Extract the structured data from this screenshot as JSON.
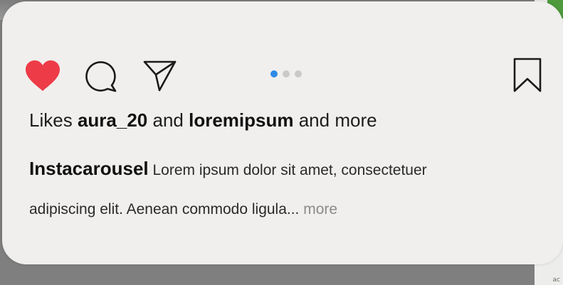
{
  "post": {
    "likes_prefix": "Likes",
    "like_user_1": "aura_20",
    "likes_and": "and",
    "like_user_2": "loremipsum",
    "likes_suffix": "and more",
    "caption_user": "Instacarousel",
    "caption_line_1": "Lorem ipsum dolor sit amet, consectetuer",
    "caption_line_2": "adipiscing elit. Aenean commodo ligula...",
    "more_label": "more"
  },
  "carousel": {
    "total": 3,
    "active_index": 0
  },
  "icons": {
    "like": "heart-icon",
    "comment": "comment-icon",
    "share": "paper-plane-icon",
    "save": "bookmark-icon"
  },
  "colors": {
    "heart": "#ee3b48",
    "active_dot": "#2e8ae6",
    "inactive_dot": "#c9c9c9",
    "card_bg": "#f0efed"
  },
  "corner_text": "ac"
}
